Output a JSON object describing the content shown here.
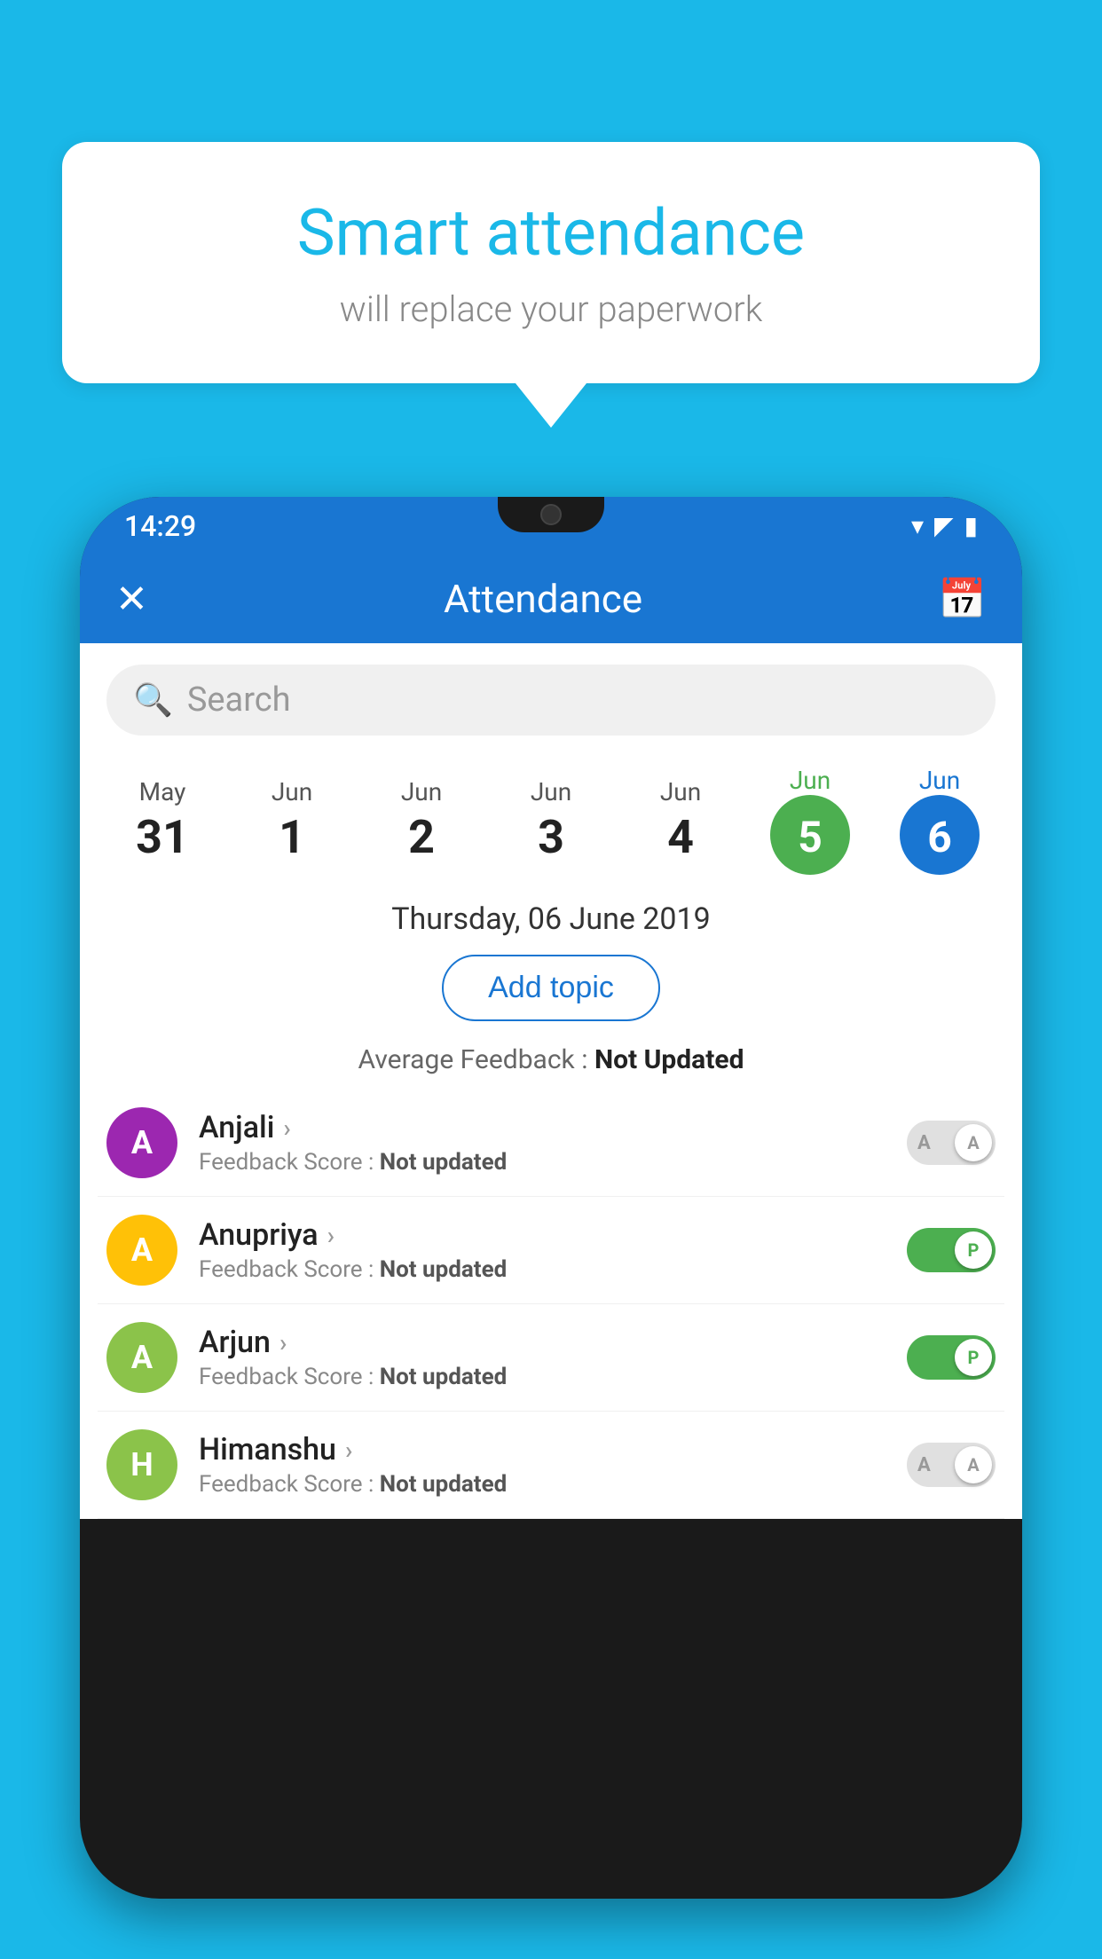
{
  "background_color": "#1ab8e8",
  "speech_bubble": {
    "title": "Smart attendance",
    "subtitle": "will replace your paperwork"
  },
  "phone": {
    "status_bar": {
      "time": "14:29",
      "icons": [
        "wifi",
        "signal",
        "battery"
      ]
    },
    "app_bar": {
      "title": "Attendance",
      "close_label": "✕",
      "calendar_label": "📅"
    },
    "search": {
      "placeholder": "Search"
    },
    "date_strip": {
      "dates": [
        {
          "month": "May",
          "day": "31",
          "selected": false
        },
        {
          "month": "Jun",
          "day": "1",
          "selected": false
        },
        {
          "month": "Jun",
          "day": "2",
          "selected": false
        },
        {
          "month": "Jun",
          "day": "3",
          "selected": false
        },
        {
          "month": "Jun",
          "day": "4",
          "selected": false
        },
        {
          "month": "Jun",
          "day": "5",
          "selected": "green"
        },
        {
          "month": "Jun",
          "day": "6",
          "selected": "blue"
        }
      ]
    },
    "selected_date_label": "Thursday, 06 June 2019",
    "add_topic_label": "Add topic",
    "avg_feedback_label": "Average Feedback :",
    "avg_feedback_value": "Not Updated",
    "students": [
      {
        "name": "Anjali",
        "initial": "A",
        "avatar_color": "#9c27b0",
        "feedback_label": "Feedback Score :",
        "feedback_value": "Not updated",
        "attendance": "A",
        "attendance_on": false
      },
      {
        "name": "Anupriya",
        "initial": "A",
        "avatar_color": "#ffc107",
        "feedback_label": "Feedback Score :",
        "feedback_value": "Not updated",
        "attendance": "P",
        "attendance_on": true
      },
      {
        "name": "Arjun",
        "initial": "A",
        "avatar_color": "#8bc34a",
        "feedback_label": "Feedback Score :",
        "feedback_value": "Not updated",
        "attendance": "P",
        "attendance_on": true
      },
      {
        "name": "Himanshu",
        "initial": "H",
        "avatar_color": "#8bc34a",
        "feedback_label": "Feedback Score :",
        "feedback_value": "Not updated",
        "attendance": "A",
        "attendance_on": false
      }
    ]
  }
}
